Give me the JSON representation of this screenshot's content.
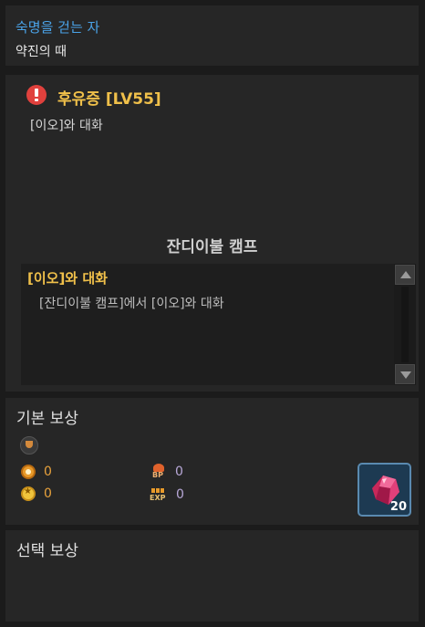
{
  "header": {
    "series_name": "숙명을 걷는 자",
    "chapter_name": "약진의 때"
  },
  "quest": {
    "title": "후유증 [LV55]",
    "summary": "[이오]와 대화",
    "location": "잔디이불 캠프",
    "objective": {
      "title": "[이오]와 대화",
      "description": "[잔디이불 캠프]에서 [이오]와 대화"
    }
  },
  "basic_reward": {
    "title": "기본 보상",
    "gold": "0",
    "star_coin": "0",
    "bp": "0",
    "exp": "0",
    "item_count": "20",
    "item_icon": "pink-crystal-icon"
  },
  "choice_reward": {
    "title": "선택 보상"
  },
  "colors": {
    "series_blue": "#4aa3e8",
    "quest_gold": "#f0c04a",
    "alert_red": "#e0413d",
    "reward_orange": "#e8a23c",
    "reward_purple": "#b8a8d8",
    "panel_bg": "#262626"
  }
}
